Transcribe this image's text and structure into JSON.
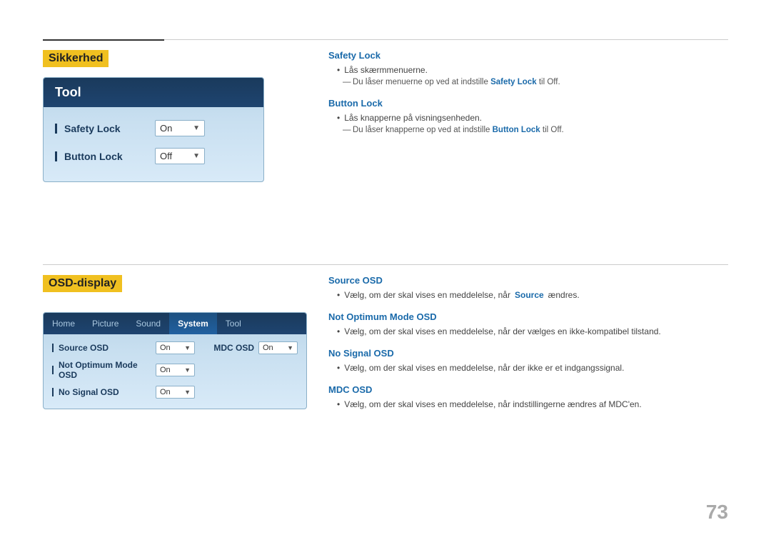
{
  "page": {
    "number": "73"
  },
  "sikkerhed": {
    "title": "Sikkerhed",
    "tool_header": "Tool",
    "safety_lock_label": "Safety Lock",
    "safety_lock_value": "On",
    "button_lock_label": "Button Lock",
    "button_lock_value": "Off",
    "safety_lock_bar": "|",
    "button_lock_bar": "|"
  },
  "sikkerhed_desc": {
    "safety_lock_title": "Safety Lock",
    "safety_lock_bullet": "Lås skærmmenuerne.",
    "safety_lock_sub": "Du låser menuerne op ved at indstille ",
    "safety_lock_sub_bold": "Safety Lock",
    "safety_lock_sub_suffix": " til Off.",
    "button_lock_title": "Button Lock",
    "button_lock_bullet": "Lås knapperne på visningsenheden.",
    "button_lock_sub": "Du låser knapperne op ved at indstille ",
    "button_lock_sub_bold": "Button Lock",
    "button_lock_sub_suffix": " til Off."
  },
  "osd": {
    "title": "OSD-display",
    "tabs": [
      "Home",
      "Picture",
      "Sound",
      "System",
      "Tool"
    ],
    "active_tab": "System",
    "source_osd_label": "Source OSD",
    "source_osd_value": "On",
    "not_optimum_label": "Not Optimum Mode OSD",
    "not_optimum_value": "On",
    "no_signal_label": "No Signal OSD",
    "no_signal_value": "On",
    "mdc_osd_label": "MDC OSD",
    "mdc_osd_value": "On"
  },
  "osd_desc": {
    "source_osd_title": "Source OSD",
    "source_osd_bullet": "Vælg, om der skal vises en meddelelse, når ",
    "source_osd_bullet_bold": "Source",
    "source_osd_bullet_suffix": " ændres.",
    "not_optimum_title": "Not Optimum Mode OSD",
    "not_optimum_bullet": "Vælg, om der skal vises en meddelelse, når der vælges en ikke-kompatibel tilstand.",
    "no_signal_title": "No Signal OSD",
    "no_signal_bullet": "Vælg, om der skal vises en meddelelse, når der ikke er et indgangssignal.",
    "mdc_osd_title": "MDC OSD",
    "mdc_osd_bullet": "Vælg, om der skal vises en meddelelse, når indstillingerne ændres af MDC'en."
  }
}
